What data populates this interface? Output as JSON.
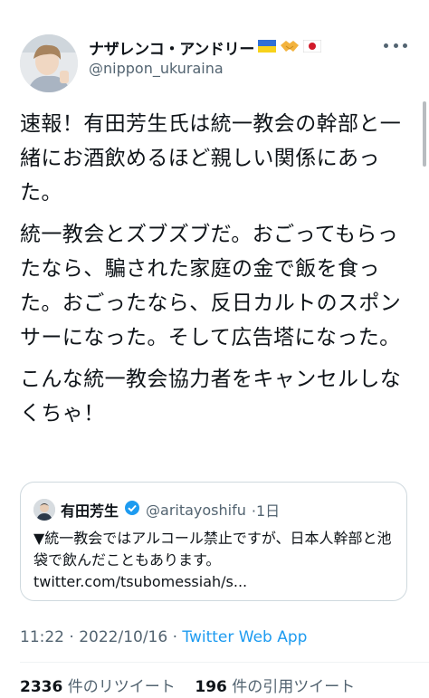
{
  "author": {
    "display_name": "ナザレンコ・アンドリー",
    "handle": "@nippon_ukuraina",
    "badges": [
      "ukraine-flag",
      "handshake",
      "japan-flag"
    ]
  },
  "tweet": {
    "paragraphs": [
      "速報！有田芳生氏は統一教会の幹部と一緒にお酒飲めるほど親しい関係にあった。",
      "統一教会とズブズブだ。おごってもらったなら、騙された家庭の金で飯を食った。おごったなら、反日カルトのスポンサーになった。そして広告塔になった。",
      "こんな統一教会協力者をキャンセルしなくちゃ！"
    ]
  },
  "quote": {
    "name": "有田芳生",
    "handle": "@aritayoshifu",
    "time": "·1日",
    "text": "▼統一教会ではアルコール禁止ですが、日本人幹部と池袋で飲んだこともあります。 twitter.com/tsubomessiah/s..."
  },
  "meta": {
    "time": "11:22 · 2022/10/16 · ",
    "app": "Twitter Web App"
  },
  "stats": {
    "retweets_count": "2336",
    "retweets_label": "件のリツイート",
    "quotes_count": "196",
    "quotes_label": "件の引用ツイート"
  },
  "colors": {
    "accent": "#1d9bf0",
    "muted": "#536471",
    "text": "#0f1419"
  }
}
